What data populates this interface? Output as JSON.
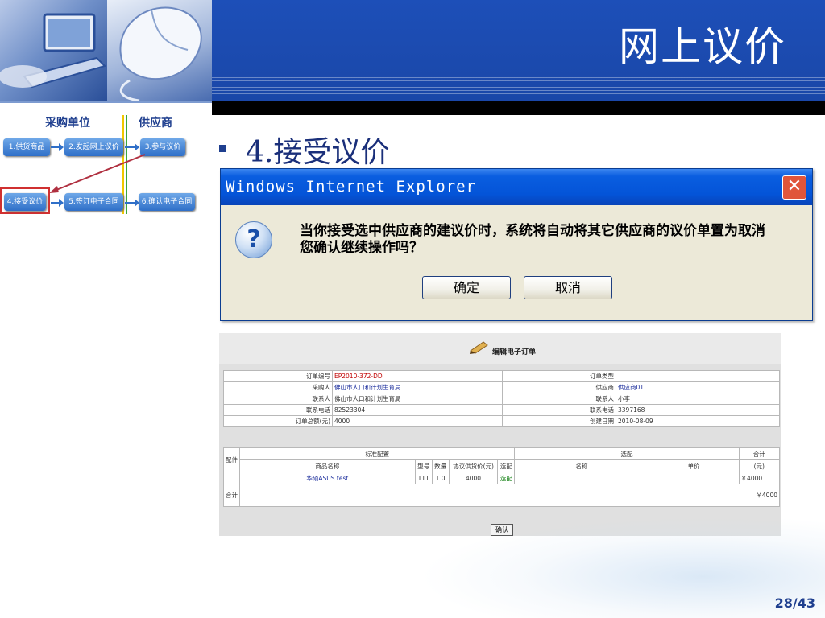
{
  "slide": {
    "title": "网上议价",
    "page_number": "28/43",
    "bullet": "4.接受议价"
  },
  "flow": {
    "col1_header": "采购单位",
    "col2_header": "供应商",
    "steps": {
      "s1": "1.供货商品",
      "s2": "2.发起网上议价",
      "s3": "3.参与议价",
      "s4": "4.接受议价",
      "s5": "5.签订电子合同",
      "s6": "6.确认电子合同"
    }
  },
  "dialog": {
    "title": "Windows Internet Explorer",
    "close_glyph": "✕",
    "icon_glyph": "?",
    "message_line1": "当你接受选中供应商的建议价时，系统将自动将其它供应商的议价单置为取消",
    "message_line2": "您确认继续操作吗？",
    "ok_label": "确定",
    "cancel_label": "取消"
  },
  "form": {
    "title": "编辑电子订单",
    "fields": {
      "order_no_label": "订单编号",
      "order_no": "EP2010-372-DD",
      "order_type_label": "订单类型",
      "order_type": "",
      "purchaser_label": "采购人",
      "purchaser": "佛山市人口和计划生育局",
      "supplier_label": "供应商",
      "supplier": "供应商01",
      "contact1_label": "联系人",
      "contact1": "佛山市人口和计划生育局",
      "contact2_label": "联系人",
      "contact2": "小李",
      "phone1_label": "联系电话",
      "phone1": "82523304",
      "phone2_label": "联系电话",
      "phone2": "3397168",
      "total_label": "订单总额(元)",
      "total": "4000",
      "created_label": "创建日期",
      "created": "2010-08-09"
    },
    "detail": {
      "h_parts": "配件",
      "h_standard": "标准配置",
      "h_optional": "选配",
      "h_total": "合计",
      "h_name": "商品名称",
      "h_model": "型号",
      "h_qty": "数量",
      "h_price": "协议供货价(元)",
      "h_option": "选配",
      "h_opt_name": "名称",
      "h_unit_price": "单价",
      "h_yuan": "(元)",
      "row_name": "华硕ASUS test",
      "row_model": "111",
      "row_qty": "1.0",
      "row_price": "4000",
      "row_option": "选配",
      "row_total": "￥4000",
      "sum_label": "合计",
      "sum_value": "￥4000"
    },
    "confirm_label": "确认"
  }
}
